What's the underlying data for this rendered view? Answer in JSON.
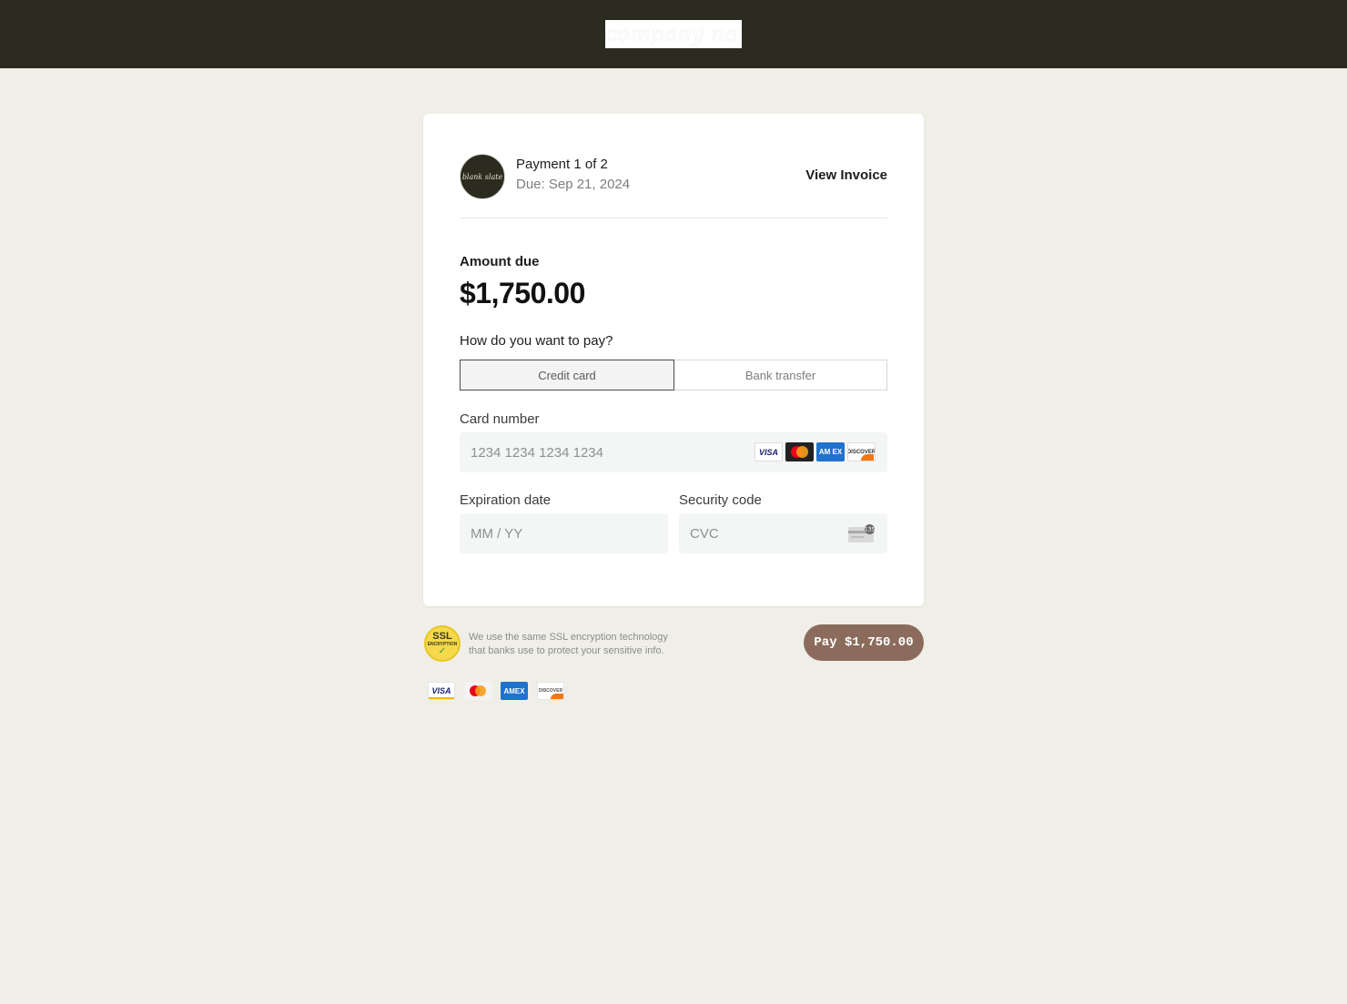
{
  "header": {
    "logo_text": "company name"
  },
  "payment": {
    "avatar_text": "blank slate",
    "title": "Payment 1 of 2",
    "due": "Due: Sep 21, 2024",
    "view_invoice": "View Invoice"
  },
  "amount": {
    "label": "Amount due",
    "value": "$1,750.00"
  },
  "method": {
    "question": "How do you want to pay?",
    "options": [
      {
        "label": "Credit card",
        "selected": true
      },
      {
        "label": "Bank transfer",
        "selected": false
      }
    ]
  },
  "form": {
    "card_number": {
      "label": "Card number",
      "placeholder": "1234 1234 1234 1234",
      "value": ""
    },
    "expiration": {
      "label": "Expiration date",
      "placeholder": "MM / YY",
      "value": ""
    },
    "security": {
      "label": "Security code",
      "placeholder": "CVC",
      "value": ""
    }
  },
  "brands": {
    "visa": "VISA",
    "amex_short": "AM EX",
    "amex": "AMEX",
    "discover": "DISCOVER",
    "cvc_icon_text": "135"
  },
  "footer": {
    "ssl_badge_line1": "SSL",
    "ssl_badge_line2": "ENCRYPTION",
    "ssl_text_line1": "We use the same SSL encryption technology",
    "ssl_text_line2": "that banks use to protect your sensitive info.",
    "pay_button": "Pay $1,750.00"
  },
  "colors": {
    "topbar": "#2b2c1f",
    "background": "#f0efe7",
    "pay_button": "#8b6c5c"
  }
}
